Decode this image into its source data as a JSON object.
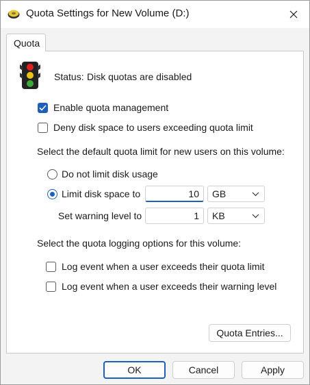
{
  "window": {
    "title": "Quota Settings for New Volume (D:)",
    "icons": {
      "app": "drive-icon",
      "close": "close-icon"
    }
  },
  "tab": {
    "label": "Quota"
  },
  "status": {
    "icon": "traffic-light-icon",
    "label": "Status:",
    "value": "Disk quotas are disabled"
  },
  "options": {
    "enable_quota": {
      "label": "Enable quota management",
      "checked": true
    },
    "deny_space": {
      "label": "Deny disk space to users exceeding quota limit",
      "checked": false
    }
  },
  "default_limit": {
    "heading": "Select the default quota limit for new users on this volume:",
    "no_limit": {
      "label": "Do not limit disk usage",
      "selected": false
    },
    "limit": {
      "label": "Limit disk space to",
      "selected": true,
      "value": "10",
      "unit": "GB"
    },
    "warning": {
      "label": "Set warning level to",
      "value": "1",
      "unit": "KB"
    }
  },
  "logging": {
    "heading": "Select the quota logging options for this volume:",
    "over_limit": {
      "label": "Log event when a user exceeds their quota limit",
      "checked": false
    },
    "over_warning": {
      "label": "Log event when a user exceeds their warning level",
      "checked": false
    }
  },
  "buttons": {
    "entries": "Quota Entries...",
    "ok": "OK",
    "cancel": "Cancel",
    "apply": "Apply"
  },
  "colors": {
    "accent": "#1f5fb8",
    "dialog_bg": "#f3f3f3"
  }
}
